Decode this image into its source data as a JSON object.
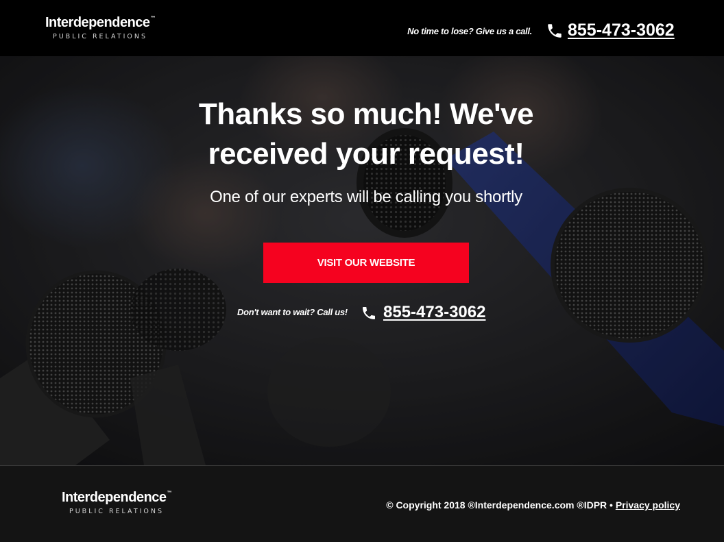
{
  "brand": {
    "name": "Interdependence",
    "tm": "™",
    "tagline": "PUBLIC RELATIONS"
  },
  "header": {
    "call_prompt": "No time to lose? Give us a call.",
    "phone": "855-473-3062",
    "phone_icon": "phone-icon"
  },
  "hero": {
    "headline": "Thanks so much! We've received your request!",
    "subhead": "One of our experts will be calling you shortly",
    "cta_label": "VISIT OUR WEBSITE",
    "call_prompt": "Don't want to wait? Call us!",
    "phone": "855-473-3062",
    "background": "microphones-press-conference"
  },
  "footer": {
    "copyright": "© Copyright 2018 ®Interdependence.com ®IDPR •",
    "privacy_label": "Privacy policy"
  },
  "colors": {
    "header_bg": "#000000",
    "cta_red": "#f5021f",
    "footer_bg": "#141414",
    "text": "#ffffff"
  }
}
